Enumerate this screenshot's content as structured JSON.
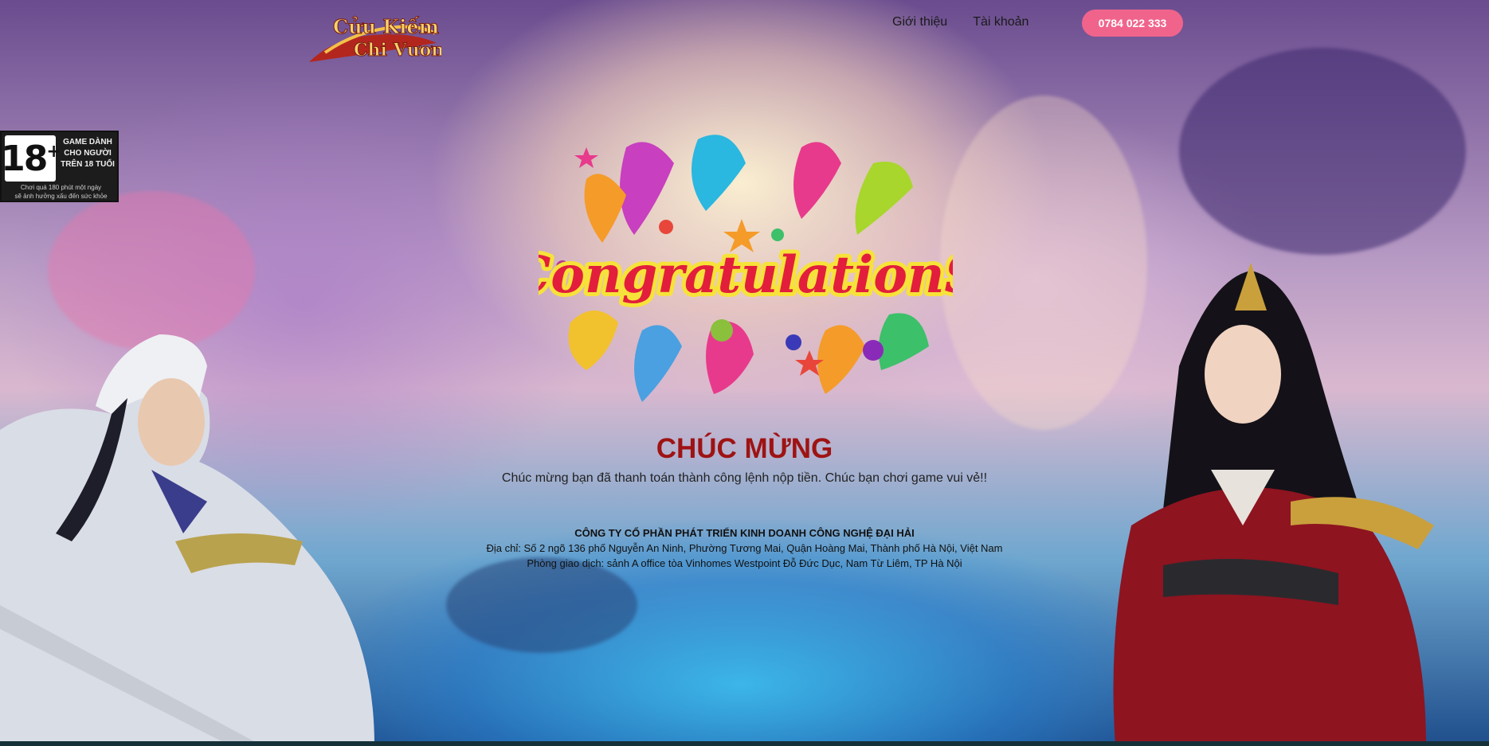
{
  "header": {
    "logo_alt": "Cửu Kiếm Chi Vương",
    "nav": [
      {
        "label": "Giới thiệu"
      },
      {
        "label": "Tài khoản"
      }
    ],
    "hotline": "0784 022 333"
  },
  "age_badge": {
    "age": "18",
    "plus": "+",
    "line1": "GAME DÀNH",
    "line2": "CHO NGƯỜI",
    "line3": "TRÊN 18 TUỔI",
    "warning_line1": "Chơi quá 180 phút một ngày",
    "warning_line2": "sẽ ảnh hưởng xấu đến sức khỏe"
  },
  "banner_text": "CongratulationS",
  "main": {
    "title": "CHÚC MỪNG",
    "message": "Chúc mừng bạn đã thanh toán thành công lệnh nộp tiền. Chúc bạn chơi game vui vẻ!!"
  },
  "footer": {
    "company": "CÔNG TY CỔ PHẦN PHÁT TRIỂN KINH DOANH CÔNG NGHỆ ĐẠI HẢI",
    "address": "Địa chỉ: Số 2 ngõ 136 phố Nguyễn An Ninh, Phường Tương Mai, Quận Hoàng Mai, Thành phố Hà Nội, Việt Nam",
    "office": "Phòng giao dịch: sảnh A office tòa Vinhomes Westpoint Đỗ Đức Dục, Nam Từ Liêm, TP Hà Nội"
  },
  "colors": {
    "title": "#9e1313",
    "hotline_bg": "#f0648c"
  }
}
